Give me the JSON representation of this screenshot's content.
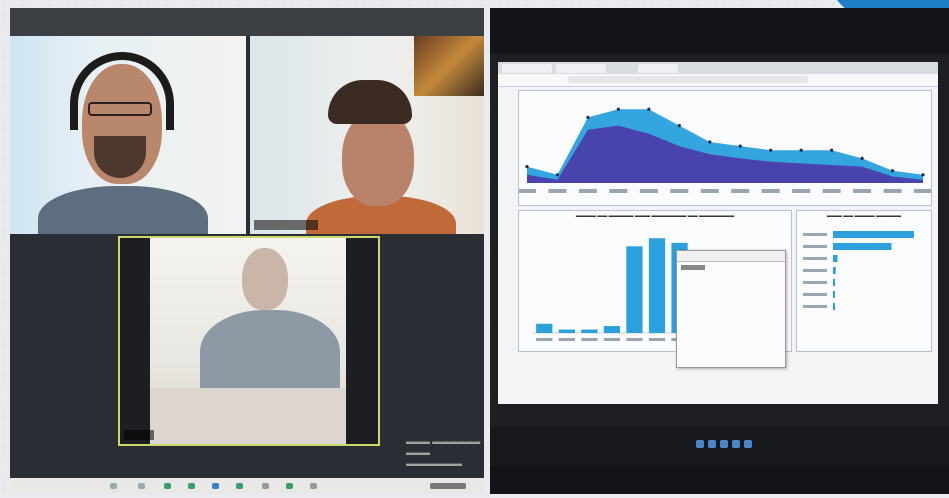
{
  "colors": {
    "accent": "#1e7fc9",
    "dashboard_blue": "#2aa0dd",
    "dashboard_purple": "#4b3aa6",
    "tile_highlight": "#c9d96a"
  },
  "video_call": {
    "participant_tiles": 3,
    "active_speaker_highlight": true
  },
  "dashboard": {
    "area_chart": {
      "series": [
        {
          "values": [
            2,
            1,
            8,
            9,
            9,
            7,
            5,
            4.5,
            4,
            4,
            4,
            3,
            1.5,
            1
          ]
        },
        {
          "values": [
            1,
            0.4,
            6.5,
            7,
            6,
            4.5,
            3.5,
            3,
            2.6,
            2.4,
            2.2,
            2,
            0.8,
            0.4
          ]
        }
      ]
    },
    "bar_chart": {
      "values": [
        0.8,
        0.3,
        0.3,
        0.6,
        7.5,
        8.2,
        7.8,
        0.2,
        0.2,
        0.9,
        0.1
      ]
    },
    "hbar_chart": {
      "values": [
        9,
        6.5,
        0.5,
        0.3,
        0.2,
        0.2,
        0.1
      ]
    }
  }
}
